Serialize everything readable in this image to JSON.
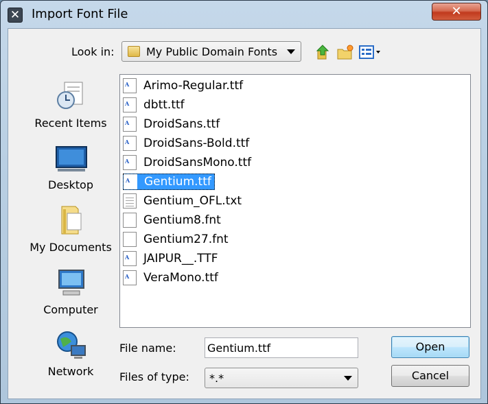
{
  "window": {
    "title": "Import Font File",
    "close_glyph": "✕"
  },
  "lookin": {
    "label": "Look in:",
    "value": "My Public Domain Fonts"
  },
  "toolbar": {
    "up_icon": "up-folder-icon",
    "new_folder_icon": "new-folder-icon",
    "view_menu_icon": "view-menu-icon"
  },
  "places": [
    {
      "label": "Recent Items",
      "icon": "recent-items-icon"
    },
    {
      "label": "Desktop",
      "icon": "desktop-icon"
    },
    {
      "label": "My Documents",
      "icon": "my-documents-icon"
    },
    {
      "label": "Computer",
      "icon": "computer-icon"
    },
    {
      "label": "Network",
      "icon": "network-icon"
    }
  ],
  "files": [
    {
      "name": "Arimo-Regular.ttf",
      "type": "font",
      "selected": false
    },
    {
      "name": "dbtt.ttf",
      "type": "font",
      "selected": false
    },
    {
      "name": "DroidSans.ttf",
      "type": "font",
      "selected": false
    },
    {
      "name": "DroidSans-Bold.ttf",
      "type": "font",
      "selected": false
    },
    {
      "name": "DroidSansMono.ttf",
      "type": "font",
      "selected": false
    },
    {
      "name": "Gentium.ttf",
      "type": "font",
      "selected": true
    },
    {
      "name": "Gentium_OFL.txt",
      "type": "text",
      "selected": false
    },
    {
      "name": "Gentium8.fnt",
      "type": "blank",
      "selected": false
    },
    {
      "name": "Gentium27.fnt",
      "type": "blank",
      "selected": false
    },
    {
      "name": "JAIPUR__.TTF",
      "type": "font",
      "selected": false
    },
    {
      "name": "VeraMono.ttf",
      "type": "font",
      "selected": false
    }
  ],
  "filename": {
    "label": "File name:",
    "value": "Gentium.ttf"
  },
  "filetype": {
    "label": "Files of type:",
    "value": "*.*"
  },
  "buttons": {
    "open": "Open",
    "cancel": "Cancel"
  },
  "colors": {
    "selection": "#3399ff",
    "close_button": "#c13a1d"
  }
}
